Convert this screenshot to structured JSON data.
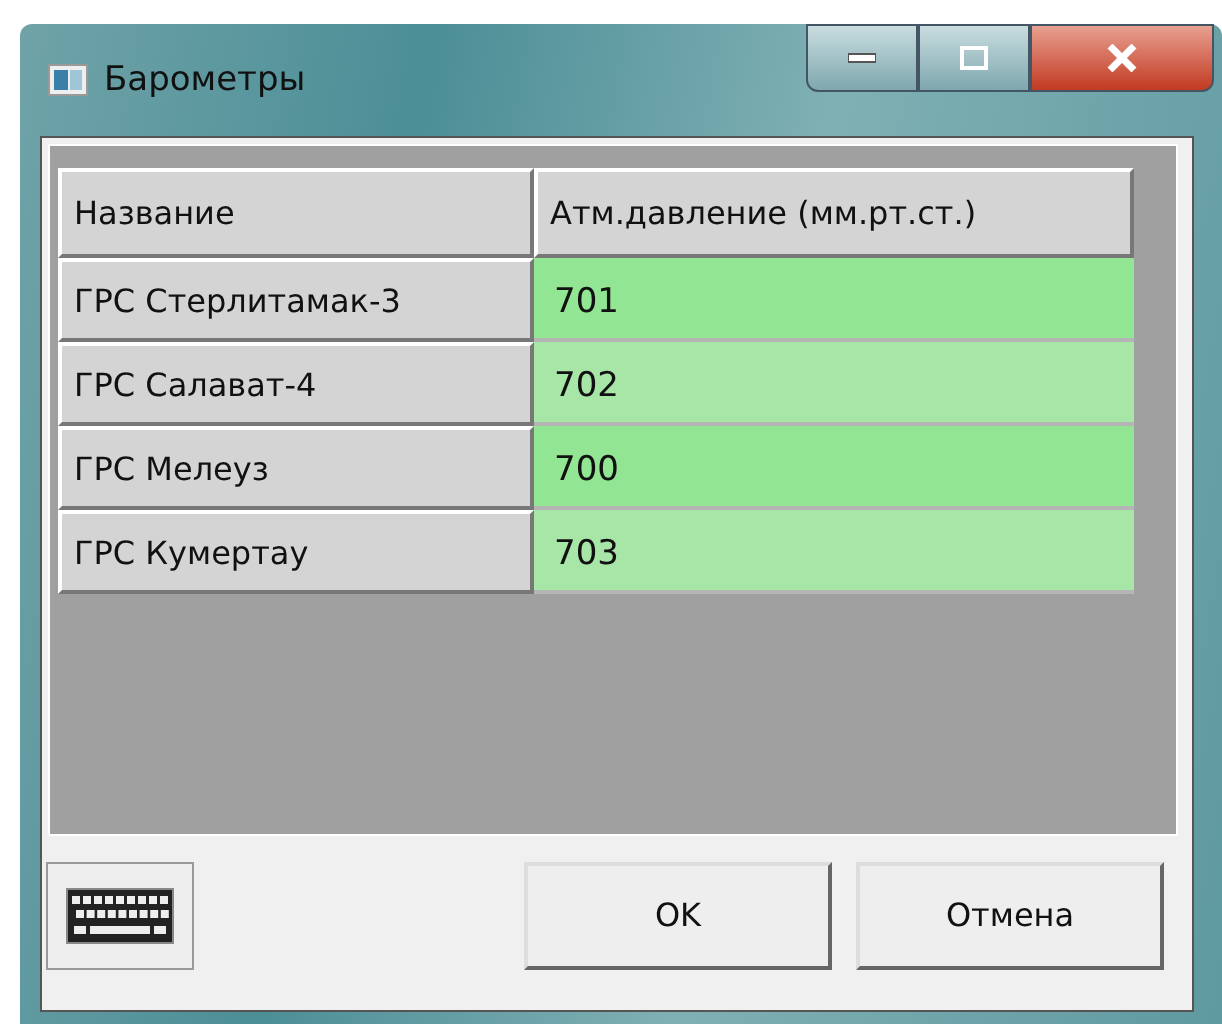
{
  "window": {
    "title": "Барометры"
  },
  "table": {
    "columns": [
      "Название",
      "Атм.давление (мм.рт.ст.)"
    ],
    "rows": [
      {
        "name": "ГРС Стерлитамак-3",
        "value": "701"
      },
      {
        "name": "ГРС Салават-4",
        "value": "702"
      },
      {
        "name": "ГРС Мелеуз",
        "value": "700"
      },
      {
        "name": "ГРС Кумертау",
        "value": "703"
      }
    ]
  },
  "buttons": [
    "OK",
    "Отмена"
  ]
}
